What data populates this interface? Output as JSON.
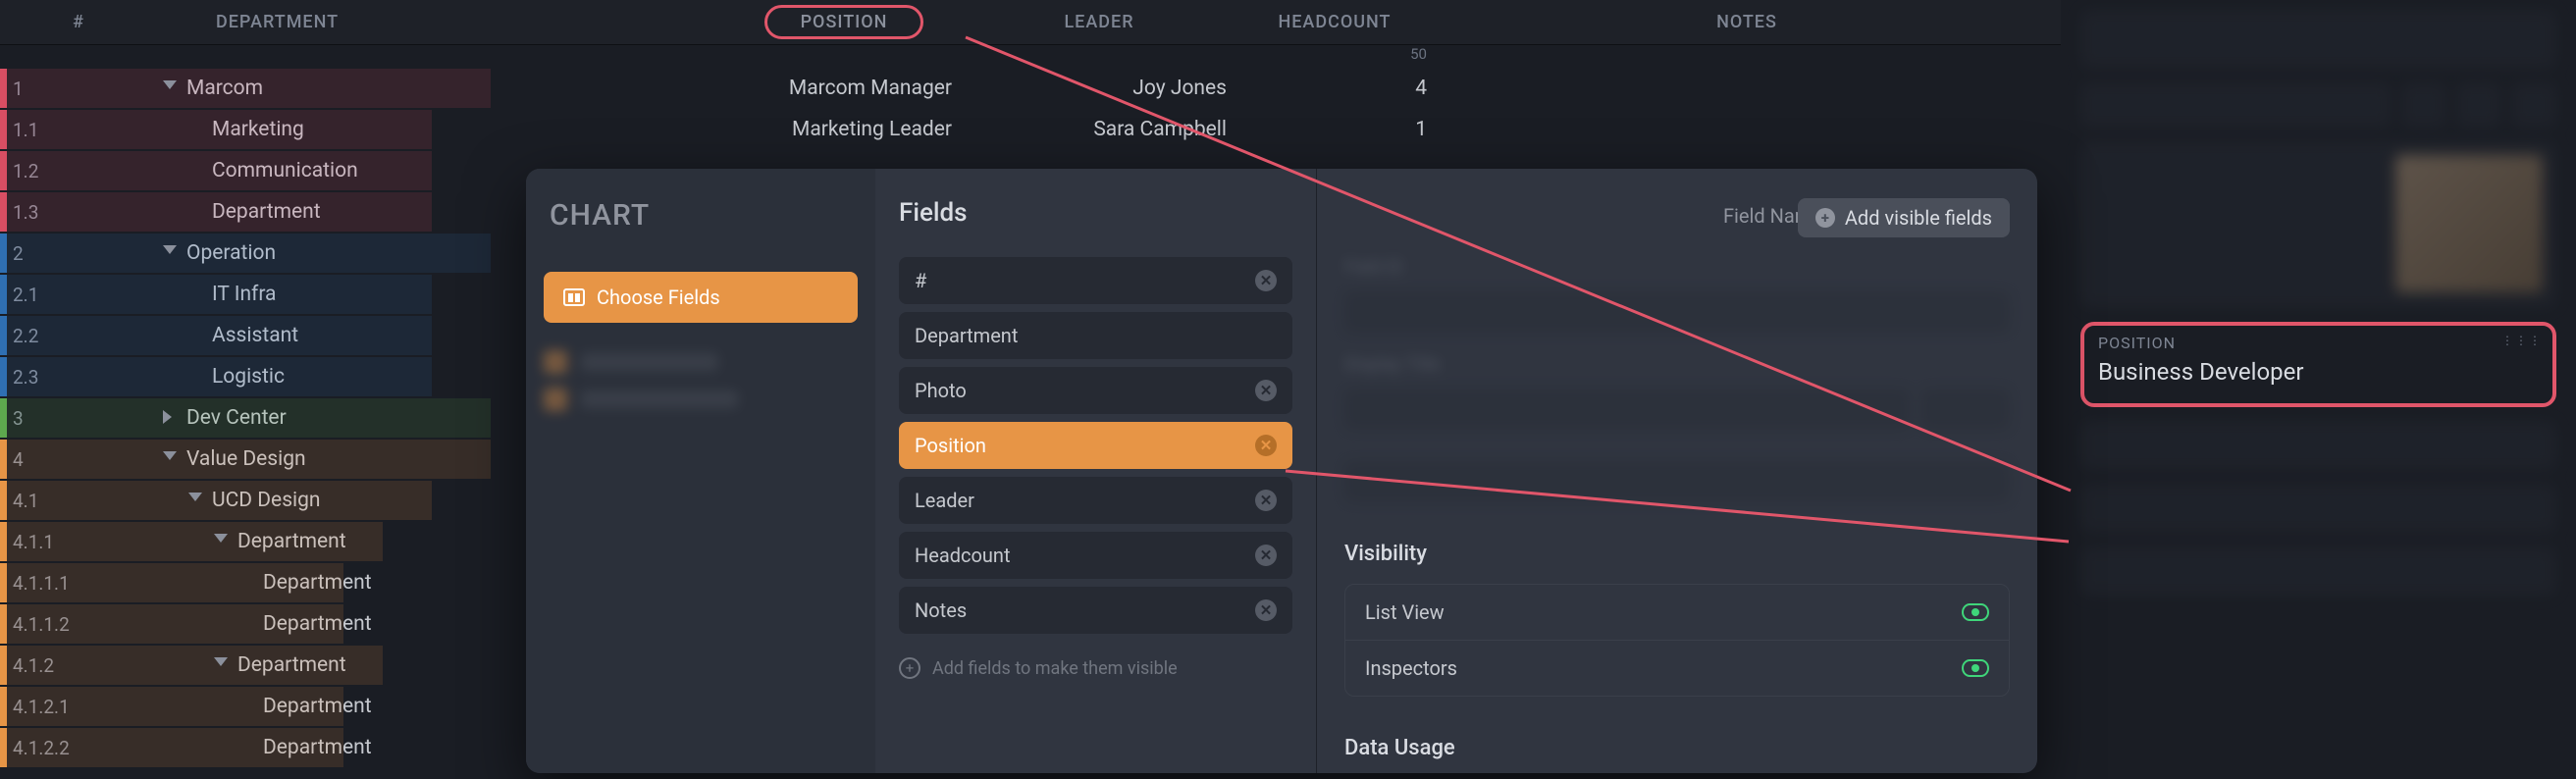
{
  "columns": {
    "num": "#",
    "department": "DEPARTMENT",
    "position": "POSITION",
    "leader": "LEADER",
    "headcount": "HEADCOUNT",
    "notes": "NOTES"
  },
  "aggregate": {
    "headcount": "50"
  },
  "rows": [
    {
      "n": "1",
      "dept": "Marcom",
      "indent": 0,
      "tri": "down",
      "color": "#d94f63",
      "pos": "Marcom Manager",
      "leader": "Joy Jones",
      "head": "4"
    },
    {
      "n": "1.1",
      "dept": "Marketing",
      "indent": 1,
      "tri": "",
      "color": "#d94f63",
      "pos": "Marketing Leader",
      "leader": "Sara Campbell",
      "head": "1"
    },
    {
      "n": "1.2",
      "dept": "Communication",
      "indent": 1,
      "tri": "",
      "color": "#d94f63"
    },
    {
      "n": "1.3",
      "dept": "Department",
      "indent": 1,
      "tri": "",
      "color": "#d94f63"
    },
    {
      "n": "2",
      "dept": "Operation",
      "indent": 0,
      "tri": "down",
      "color": "#2f6fb3"
    },
    {
      "n": "2.1",
      "dept": "IT Infra",
      "indent": 1,
      "tri": "",
      "color": "#2f6fb3"
    },
    {
      "n": "2.2",
      "dept": "Assistant",
      "indent": 1,
      "tri": "",
      "color": "#2f6fb3"
    },
    {
      "n": "2.3",
      "dept": "Logistic",
      "indent": 1,
      "tri": "",
      "color": "#2f6fb3"
    },
    {
      "n": "3",
      "dept": "Dev Center",
      "indent": 0,
      "tri": "right",
      "color": "#5fa84e"
    },
    {
      "n": "4",
      "dept": "Value Design",
      "indent": 0,
      "tri": "down",
      "color": "#e79546"
    },
    {
      "n": "4.1",
      "dept": "UCD Design",
      "indent": 1,
      "tri": "down",
      "color": "#e79546"
    },
    {
      "n": "4.1.1",
      "dept": "Department",
      "indent": 2,
      "tri": "down",
      "color": "#e79546"
    },
    {
      "n": "4.1.1.1",
      "dept": "Department",
      "indent": 3,
      "tri": "",
      "color": "#e79546"
    },
    {
      "n": "4.1.1.2",
      "dept": "Department",
      "indent": 3,
      "tri": "",
      "color": "#e79546"
    },
    {
      "n": "4.1.2",
      "dept": "Department",
      "indent": 2,
      "tri": "down",
      "color": "#e79546"
    },
    {
      "n": "4.1.2.1",
      "dept": "Department",
      "indent": 3,
      "tri": "",
      "color": "#e79546"
    },
    {
      "n": "4.1.2.2",
      "dept": "Department",
      "indent": 3,
      "tri": "",
      "color": "#e79546"
    }
  ],
  "modal": {
    "title": "CHART",
    "choose": "Choose Fields",
    "fields_header": "Fields",
    "seg_name": "Field Name",
    "seg_title": "Field Title",
    "add_visible": "Add visible fields",
    "fields": [
      {
        "label": "#",
        "removable": true
      },
      {
        "label": "Department",
        "removable": false
      },
      {
        "label": "Photo",
        "removable": true
      },
      {
        "label": "Position",
        "removable": true,
        "selected": true
      },
      {
        "label": "Leader",
        "removable": true
      },
      {
        "label": "Headcount",
        "removable": true
      },
      {
        "label": "Notes",
        "removable": true
      }
    ],
    "add_hint": "Add fields to make them visible",
    "visibility_header": "Visibility",
    "vis_items": [
      "List View",
      "Inspectors"
    ],
    "data_usage": "Data Usage"
  },
  "inspector": {
    "position_label": "POSITION",
    "position_value": "Business Developer"
  }
}
